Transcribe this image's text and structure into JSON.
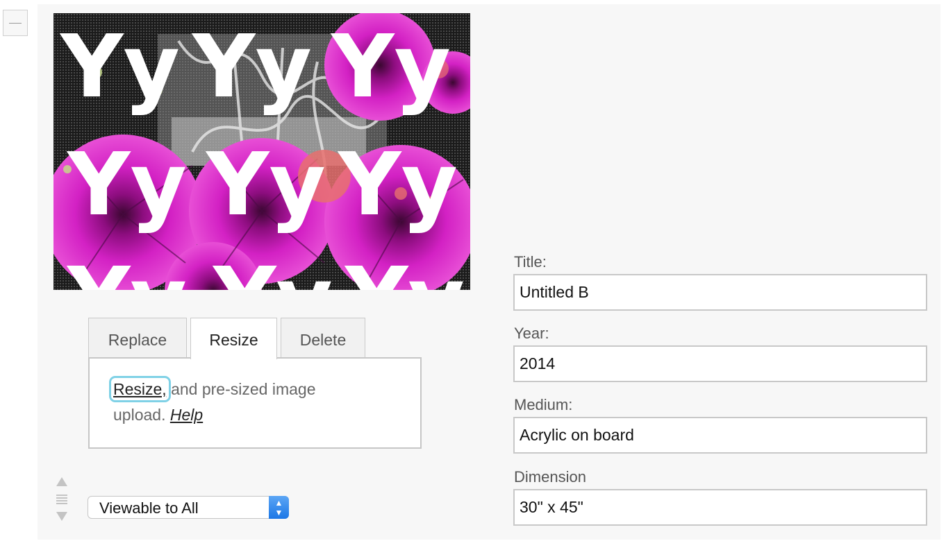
{
  "artwork": {
    "glyphs": [
      "Yy",
      "Yy",
      "Yy",
      "Yy",
      "Yy",
      "Yy",
      "Yy",
      "Yy",
      "Yy"
    ]
  },
  "tabs": [
    {
      "label": "Replace",
      "active": false
    },
    {
      "label": "Resize",
      "active": true
    },
    {
      "label": "Delete",
      "active": false
    }
  ],
  "tab_panel": {
    "link_label": "Resize,",
    "body_text": " and pre-sized image upload. ",
    "help_label": "Help"
  },
  "visibility_select": {
    "value": "Viewable to All",
    "arrow_up": "▲",
    "arrow_down": "▼"
  },
  "fields": {
    "title": {
      "label": "Title:",
      "value": "Untitled B"
    },
    "year": {
      "label": "Year:",
      "value": "2014"
    },
    "medium": {
      "label": "Medium:",
      "value": "Acrylic on board"
    },
    "dimension": {
      "label": "Dimension",
      "value": "30\" x 45\""
    }
  },
  "colors": {
    "focus_ring": "#7fd1e6",
    "select_accent": "#1c77e6",
    "magenta": "#c21fb8",
    "coral": "#e8706e"
  }
}
